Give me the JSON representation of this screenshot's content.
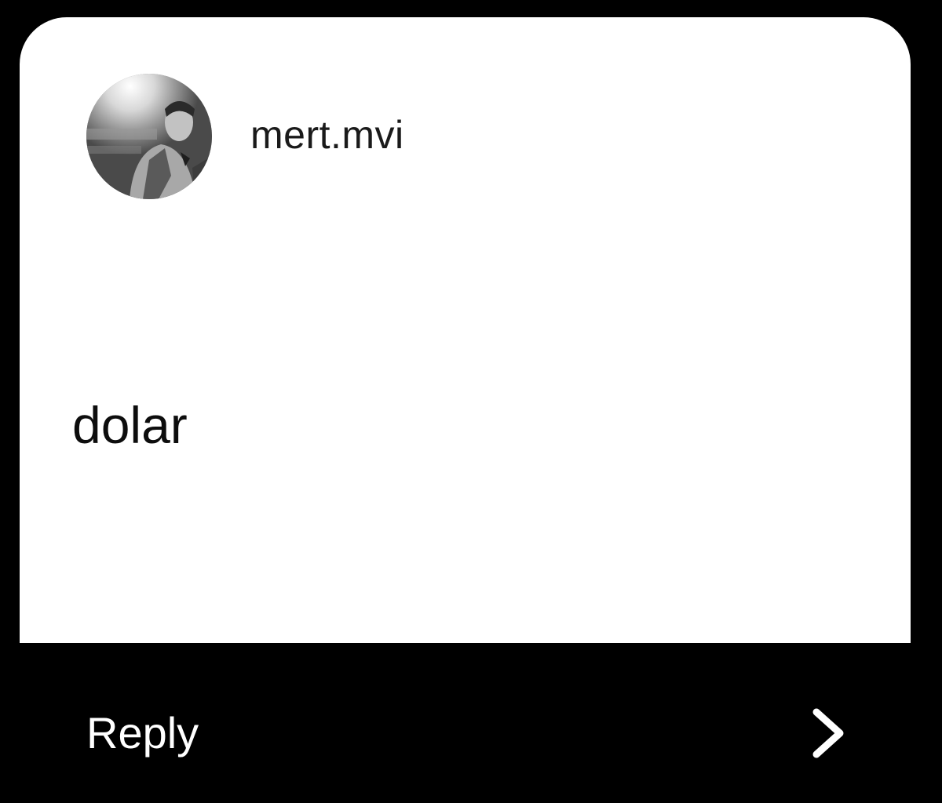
{
  "story_reply": {
    "username": "mert.mvi",
    "message": "dolar",
    "reply_label": "Reply",
    "chevron_icon": "chevron-right-icon"
  },
  "colors": {
    "background": "#000000",
    "card": "#ffffff",
    "text_dark": "#1a1a1a",
    "text_light": "#ffffff"
  }
}
